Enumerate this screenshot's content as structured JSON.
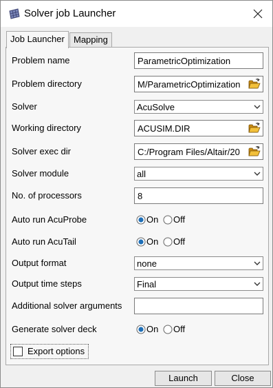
{
  "window": {
    "title": "Solver job Launcher"
  },
  "tabs": [
    {
      "label": "Job Launcher",
      "active": true
    },
    {
      "label": "Mapping",
      "active": false
    }
  ],
  "form": {
    "problem_name": {
      "label": "Problem name",
      "value": "ParametricOptimization"
    },
    "problem_directory": {
      "label": "Problem directory",
      "value": "M/ParametricOptimization"
    },
    "solver": {
      "label": "Solver",
      "value": "AcuSolve"
    },
    "working_directory": {
      "label": "Working directory",
      "value": "ACUSIM.DIR"
    },
    "solver_exec_dir": {
      "label": "Solver exec dir",
      "value": "C:/Program Files/Altair/20"
    },
    "solver_module": {
      "label": "Solver module",
      "value": "all"
    },
    "num_processors": {
      "label": "No. of processors",
      "value": "8"
    },
    "auto_run_acuprobe": {
      "label": "Auto run AcuProbe",
      "selected": "On",
      "on_label": "On",
      "off_label": "Off"
    },
    "auto_run_acutail": {
      "label": "Auto run AcuTail",
      "selected": "On",
      "on_label": "On",
      "off_label": "Off"
    },
    "output_format": {
      "label": "Output format",
      "value": "none"
    },
    "output_time_steps": {
      "label": "Output time steps",
      "value": "Final"
    },
    "additional_args": {
      "label": "Additional solver arguments",
      "value": ""
    },
    "generate_deck": {
      "label": "Generate solver deck",
      "selected": "On",
      "on_label": "On",
      "off_label": "Off"
    },
    "export_options": {
      "label": "Export options",
      "checked": false
    }
  },
  "buttons": {
    "launch": "Launch",
    "close": "Close"
  },
  "icons": {
    "app": "grid-mesh-icon",
    "close": "close-icon",
    "folder": "folder-open-icon",
    "dropdown": "chevron-down-icon"
  },
  "colors": {
    "radio_selected": "#1e6fb8",
    "folder": "#e0a21a"
  }
}
